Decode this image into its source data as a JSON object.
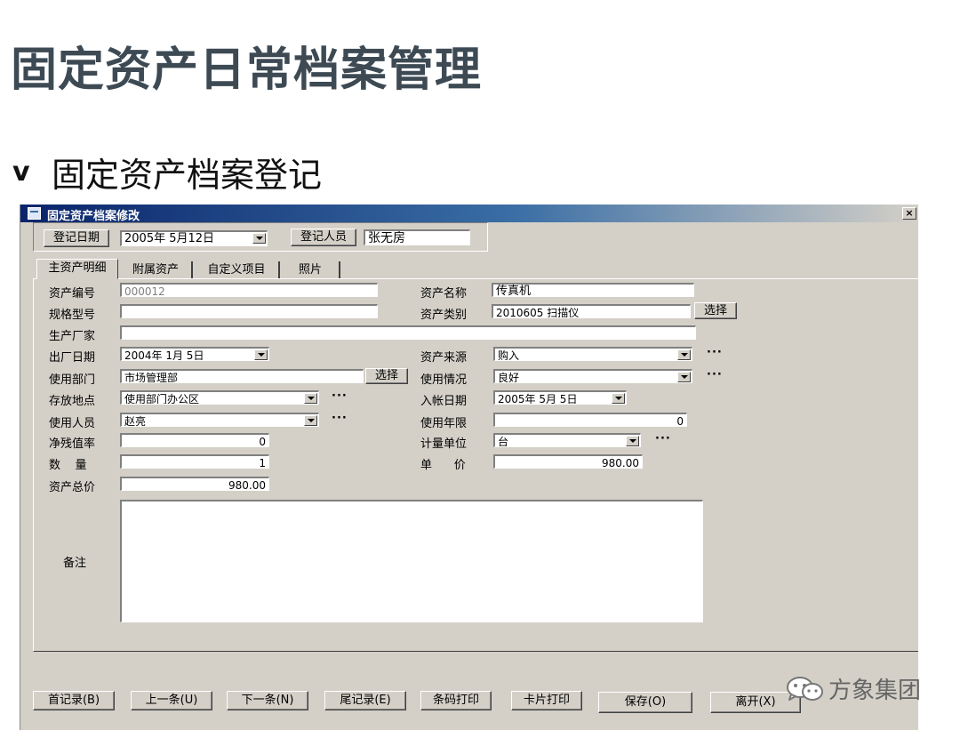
{
  "slide": {
    "title": "固定资产日常档案管理",
    "bullet_mark": "v",
    "bullet_text": "固定资产档案登记"
  },
  "window": {
    "title": "固定资产档案修改",
    "close_label": "×"
  },
  "header": {
    "reg_date_label": "登记日期",
    "reg_date_value": "2005年  5月12日",
    "reg_person_label": "登记人员",
    "reg_person_value": "张无房"
  },
  "tabs": [
    "主资产明细",
    "附属资产",
    "自定义项目",
    "照片"
  ],
  "form": {
    "asset_no_label": "资产编号",
    "asset_no_value": "000012",
    "asset_name_label": "资产名称",
    "asset_name_value": "传真机",
    "spec_label": "规格型号",
    "spec_value": "",
    "category_label": "资产类别",
    "category_value": "2010605 扫描仪",
    "select_label": "选择",
    "maker_label": "生产厂家",
    "maker_value": "",
    "mfg_date_label": "出厂日期",
    "mfg_date_value": "2004年  1月  5日",
    "source_label": "资产来源",
    "source_value": "购入",
    "dept_label": "使用部门",
    "dept_value": "市场管理部",
    "condition_label": "使用情况",
    "condition_value": "良好",
    "location_label": "存放地点",
    "location_value": "使用部门办公区",
    "entry_date_label": "入帐日期",
    "entry_date_value": "2005年  5月  5日",
    "user_label": "使用人员",
    "user_value": "赵亮",
    "life_label": "使用年限",
    "life_value": "0",
    "residual_label": "净残值率",
    "residual_value": "0",
    "unit_label": "计量单位",
    "unit_value": "台",
    "qty_label": "数    量",
    "qty_value": "1",
    "price_label": "单      价",
    "price_value": "980.00",
    "total_label": "资产总价",
    "total_value": "980.00",
    "memo_label": "备注",
    "ellipsis": "···"
  },
  "buttons": {
    "first": "首记录(B)",
    "prev": "上一条(U)",
    "next": "下一条(N)",
    "last": "尾记录(E)",
    "barcode": "条码打印",
    "card": "卡片打印",
    "save": "保存(O)",
    "exit": "离开(X)"
  },
  "watermark": {
    "text": "方象集团",
    "icon": "wechat-icon"
  }
}
